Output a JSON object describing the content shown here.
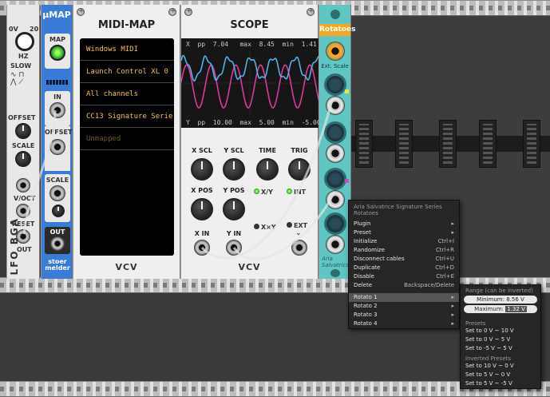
{
  "lfo": {
    "brand": "LFO",
    "maker": "BGA",
    "freq_labels": {
      "left": "0V",
      "top": "20",
      "hz": "HZ",
      "low": "0.2",
      "high": "200"
    },
    "slow_label": "SLOW",
    "offset_label": "OFFSET",
    "scale_label": "SCALE",
    "voct_label": "V/OCT",
    "reset_label": "RESET",
    "out_label": "OUT"
  },
  "umap": {
    "title": "µMAP",
    "map_label": "MAP",
    "in_label": "IN",
    "offset_label": "OFFSET",
    "scale_label": "SCALE",
    "out_label": "OUT",
    "maker": "stoer melder"
  },
  "midimap": {
    "title": "MIDI-MAP",
    "rows": [
      "Windows MIDI",
      "Launch Control XL 0",
      "All channels",
      "CC13 Signature Serie",
      "Unmapped"
    ],
    "brand": "VCV"
  },
  "scope": {
    "title": "SCOPE",
    "top_info": {
      "ch": "X",
      "pp_label": "pp",
      "pp": "7.04",
      "max_label": "max",
      "max": "8.45",
      "min_label": "min",
      "min": "1.41"
    },
    "bottom_info": {
      "ch": "Y",
      "pp_label": "pp",
      "pp": "10.00",
      "max_label": "max",
      "max": "5.00",
      "min_label": "min",
      "min": "-5.00"
    },
    "knob_labels": [
      "X SCL",
      "Y SCL",
      "TIME",
      "TRIG",
      "X POS",
      "Y POS"
    ],
    "xy_label": "X/Y",
    "xxy_label": "X×Y",
    "int_label": "INT",
    "ext_label": "EXT",
    "xin_label": "X IN",
    "yin_label": "Y IN",
    "brand": "VCV",
    "colors": {
      "x_trace": "#4fb3e8",
      "y_trace": "#e0379a"
    }
  },
  "rotatoes": {
    "title": "Rotatoes",
    "ext_scale": "Ext. Scale",
    "signature": "Aria Salvatrice",
    "accent": "#f5a623",
    "panel": "#60c6c3"
  },
  "context_menu": {
    "header": "Aria Salvatrice Signature Series Rotatoes",
    "items": [
      {
        "label": "Plugin",
        "shortcut": "▸"
      },
      {
        "label": "Preset",
        "shortcut": "▸"
      },
      {
        "label": "Initialize",
        "shortcut": "Ctrl+I"
      },
      {
        "label": "Randomize",
        "shortcut": "Ctrl+R"
      },
      {
        "label": "Disconnect cables",
        "shortcut": "Ctrl+U"
      },
      {
        "label": "Duplicate",
        "shortcut": "Ctrl+D"
      },
      {
        "label": "Disable",
        "shortcut": "Ctrl+E"
      },
      {
        "label": "Delete",
        "shortcut": "Backspace/Delete"
      }
    ],
    "rotato_items": [
      {
        "label": "Rotato 1",
        "shortcut": "▸"
      },
      {
        "label": "Rotato 2",
        "shortcut": "▸"
      },
      {
        "label": "Rotato 3",
        "shortcut": "▸"
      },
      {
        "label": "Rotato 4",
        "shortcut": "▸"
      }
    ]
  },
  "submenu": {
    "range_header": "Range (can be inverted)",
    "minimum_label": "Minimum:",
    "minimum_value": "8.56 V",
    "maximum_label": "Maximum:",
    "maximum_value": "1.32 V",
    "presets_header": "Presets",
    "presets": [
      "Set to 0 V ~ 10 V",
      "Set to 0 V ~ 5 V",
      "Set to -5 V ~ 5 V"
    ],
    "inverted_header": "Inverted Presets",
    "inverted_presets": [
      "Set to 10 V ~ 0 V",
      "Set to 5 V ~ 0 V",
      "Set to 5 V ~ -5 V"
    ]
  }
}
